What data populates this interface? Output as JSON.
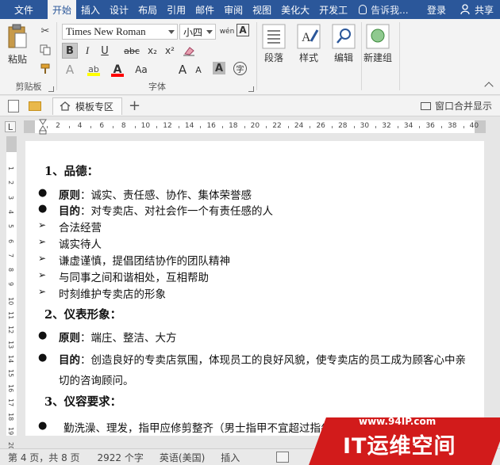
{
  "menu": {
    "tabs": [
      "文件",
      "开始",
      "插入",
      "设计",
      "布局",
      "引用",
      "邮件",
      "审阅",
      "视图",
      "美化大",
      "开发工"
    ],
    "active_index": 1,
    "tell_me": "告诉我...",
    "login": "登录",
    "share": "共享"
  },
  "ribbon": {
    "clipboard": {
      "paste": "粘贴",
      "label": "剪贴板"
    },
    "font": {
      "name": "Times New Roman",
      "size": "小四",
      "phonetic": "wén",
      "bold": "B",
      "italic": "I",
      "underline": "U",
      "strike": "abc",
      "subscript": "x₂",
      "superscript": "x²",
      "grow": "A",
      "shrink": "A",
      "case": "Aa",
      "char_shade": "A",
      "enclose": "字",
      "label": "字体"
    },
    "paragraph": "段落",
    "styles": "样式",
    "editing": "编辑",
    "new_group": "新建组"
  },
  "tabstrip": {
    "tab_label": "模板专区",
    "merge": "窗口合并显示"
  },
  "ruler": {
    "left_box": "L",
    "numbers": [
      "2",
      "4",
      "6",
      "8",
      "10",
      "12",
      "14",
      "16",
      "18",
      "20",
      "22",
      "24",
      "26",
      "28",
      "30",
      "32",
      "34",
      "36",
      "38",
      "40"
    ],
    "vnumbers": [
      "1",
      "2",
      "3",
      "4",
      "5",
      "6",
      "7",
      "8",
      "9",
      "10",
      "11",
      "12",
      "13",
      "14",
      "15",
      "16",
      "17",
      "18",
      "19",
      "20"
    ]
  },
  "document": {
    "h1": "1、品德：",
    "b1_bold": "原则",
    "b1_text": "：诚实、责任感、协作、集体荣誉感",
    "b2_bold": "目的",
    "b2_text": "：对专卖店、对社会作一个有责任感的人",
    "a1": "合法经营",
    "a2": "诚实待人",
    "a3": "谦虚谨慎，提倡团结协作的团队精神",
    "a4": "与同事之间和谐相处，互相帮助",
    "a5": "时刻维护专卖店的形象",
    "h2": "2、仪表形象：",
    "b3_bold": "原则",
    "b3_text": "：端庄、整洁、大方",
    "b4_bold": "目的",
    "b4_text": "：创造良好的专卖店氛围，体现员工的良好风貌，使专卖店的员工成为顾客心中亲",
    "b4_cont": "切的咨询顾问。",
    "h3": "3、仪容要求：",
    "b5_text": "勤洗澡、理发，指甲应修剪整齐（男士指甲不宜超过指尖），保持清洁"
  },
  "status": {
    "page": "第 4 页，共 8 页",
    "words": "2922 个字",
    "lang": "英语(美国)",
    "mode": "插入"
  },
  "watermark": {
    "url": "www.94IP.com",
    "brand": "IT运维空间"
  },
  "colors": {
    "accent": "#2b579a",
    "watermark": "#d21b1b",
    "highlight": "#ffff00",
    "font_color": "#ff0000"
  }
}
